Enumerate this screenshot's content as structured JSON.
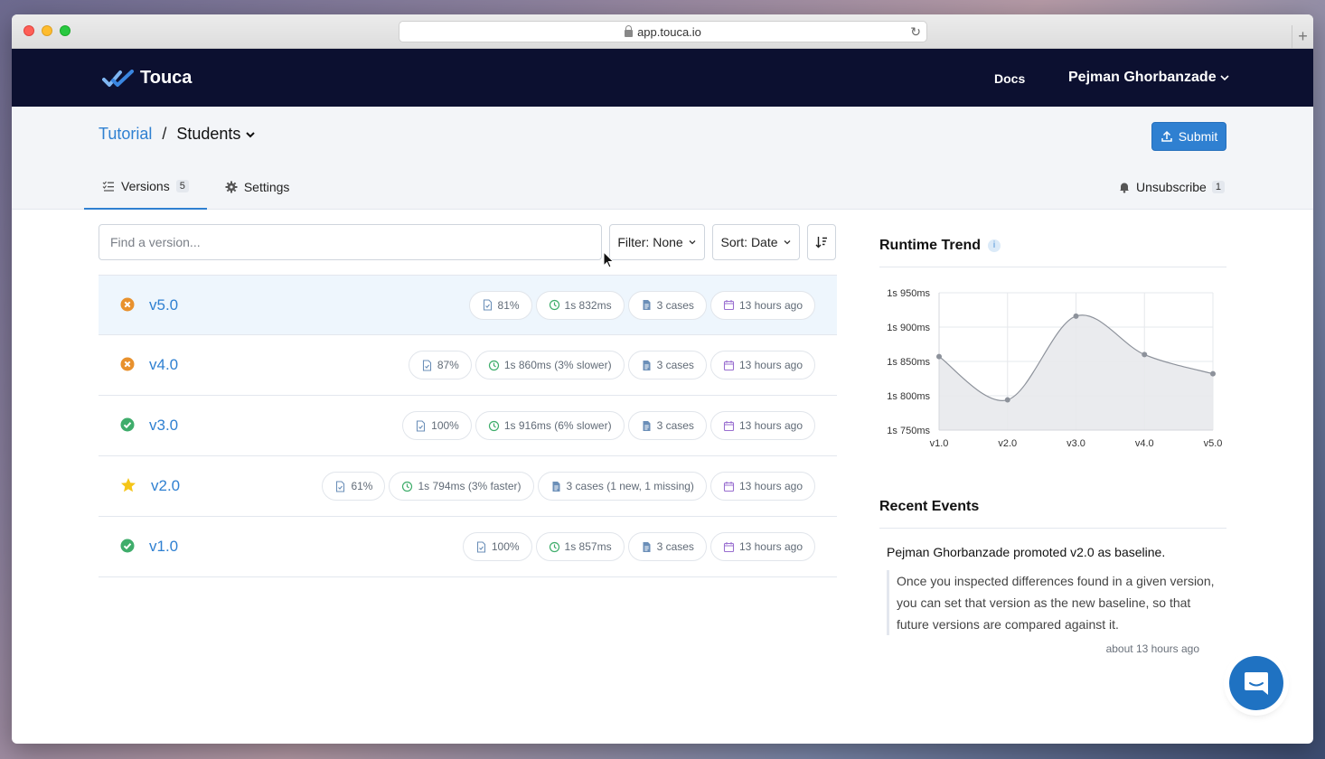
{
  "browser": {
    "url": "app.touca.io"
  },
  "nav": {
    "brand": "Touca",
    "docs": "Docs",
    "user": "Pejman Ghorbanzade"
  },
  "header": {
    "team": "Tutorial",
    "separator": "/",
    "suite": "Students",
    "submit": "Submit",
    "tabs": [
      {
        "label": "Versions",
        "count": "5"
      },
      {
        "label": "Settings"
      }
    ],
    "unsubscribe": {
      "label": "Unsubscribe",
      "count": "1"
    }
  },
  "toolbar": {
    "search_placeholder": "Find a version...",
    "filter": "Filter: None",
    "sort": "Sort: Date"
  },
  "versions": [
    {
      "status": "failed",
      "name": "v5.0",
      "match": "81%",
      "duration": "1s 832ms",
      "cases": "3 cases",
      "time": "13 hours ago"
    },
    {
      "status": "failed",
      "name": "v4.0",
      "match": "87%",
      "duration": "1s 860ms (3% slower)",
      "cases": "3 cases",
      "time": "13 hours ago"
    },
    {
      "status": "passed",
      "name": "v3.0",
      "match": "100%",
      "duration": "1s 916ms (6% slower)",
      "cases": "3 cases",
      "time": "13 hours ago"
    },
    {
      "status": "baseline",
      "name": "v2.0",
      "match": "61%",
      "duration": "1s 794ms (3% faster)",
      "cases": "3 cases (1 new, 1 missing)",
      "time": "13 hours ago"
    },
    {
      "status": "passed",
      "name": "v1.0",
      "match": "100%",
      "duration": "1s 857ms",
      "cases": "3 cases",
      "time": "13 hours ago"
    }
  ],
  "runtime": {
    "title": "Runtime Trend"
  },
  "chart_data": {
    "type": "area",
    "title": "Runtime Trend",
    "categories": [
      "v1.0",
      "v2.0",
      "v3.0",
      "v4.0",
      "v5.0"
    ],
    "values": [
      1857,
      1794,
      1916,
      1860,
      1832
    ],
    "yticks": [
      "1s 750ms",
      "1s 800ms",
      "1s 850ms",
      "1s 900ms",
      "1s 950ms"
    ],
    "ylim": [
      1750,
      1950
    ],
    "grid": true,
    "fill_color": "#e8e9ec",
    "line_color": "#8d929b"
  },
  "events": {
    "title": "Recent Events",
    "items": [
      {
        "actor": "Pejman Ghorbanzade",
        "action": " promoted ",
        "target": "v2.0",
        "suffix": " as baseline.",
        "note": "Once you inspected differences found in a given version, you can set that version as the new baseline, so that future versions are compared against it.",
        "time": "about 13 hours ago"
      }
    ]
  },
  "colors": {
    "accent": "#2f80d1",
    "nav_bg": "#0c1030",
    "failed": "#e8912d",
    "passed": "#3fad6b",
    "baseline": "#f5c518"
  }
}
